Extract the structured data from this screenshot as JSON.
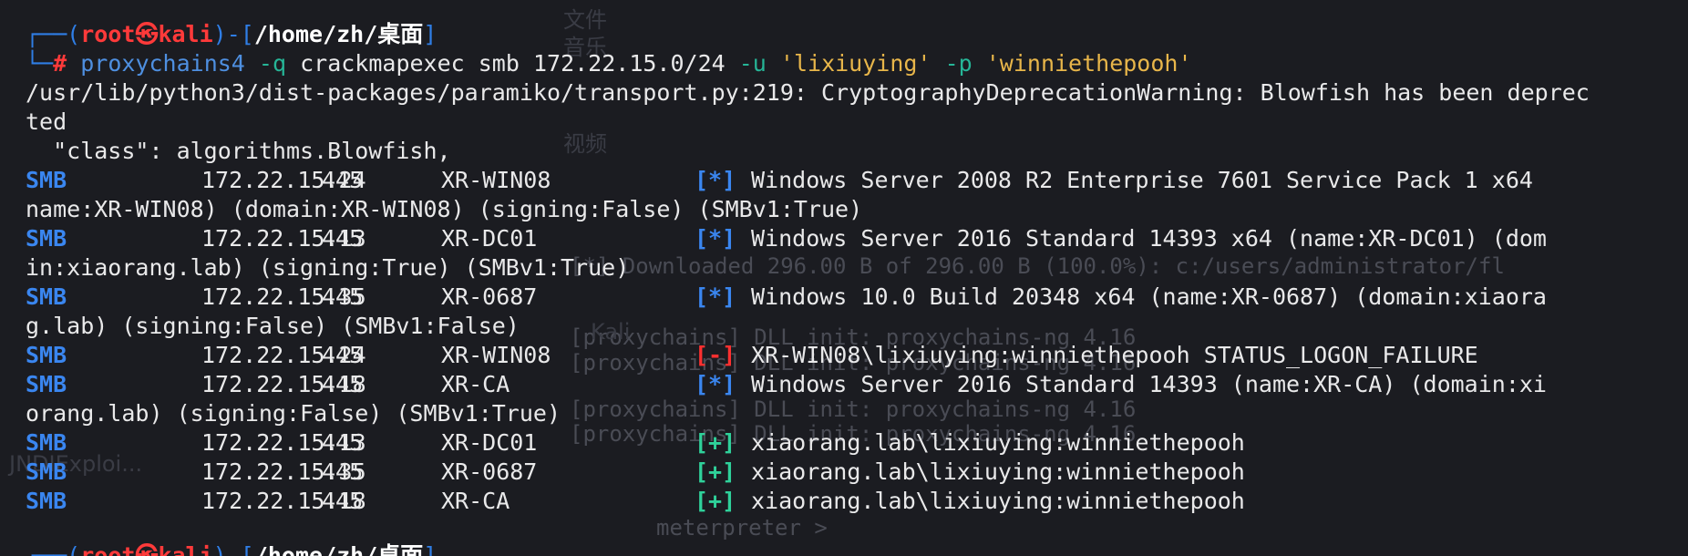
{
  "prompt": {
    "user": "root",
    "at_symbol": "㉿",
    "host": "kali",
    "cwd": "/home/zh/桌面",
    "hash": "#",
    "command": "proxychains4",
    "arg_q": "-q",
    "args1": "crackmapexec smb 172.22.15.0/24",
    "flag_u": "-u",
    "user_arg": "'lixiuying'",
    "flag_p": "-p",
    "pass_arg": "'winniethepooh'"
  },
  "warning": {
    "line1": "/usr/lib/python3/dist-packages/paramiko/transport.py:219: CryptographyDeprecationWarning: Blowfish has been deprec",
    "line2": "ted",
    "line3": "  \"class\": algorithms.Blowfish,"
  },
  "results": [
    {
      "proto": "SMB",
      "ip": "172.22.15.24",
      "port": "445",
      "host": "XR-WIN08",
      "tag": "[*]",
      "kind": "info",
      "msg": "Windows Server 2008 R2 Enterprise 7601 Service Pack 1 x64",
      "cont": "name:XR-WIN08) (domain:XR-WIN08) (signing:False) (SMBv1:True)"
    },
    {
      "proto": "SMB",
      "ip": "172.22.15.13",
      "port": "445",
      "host": "XR-DC01",
      "tag": "[*]",
      "kind": "info",
      "msg": "Windows Server 2016 Standard 14393 x64 (name:XR-DC01) (dom",
      "cont": "in:xiaorang.lab) (signing:True) (SMBv1:True)"
    },
    {
      "proto": "SMB",
      "ip": "172.22.15.35",
      "port": "445",
      "host": "XR-0687",
      "tag": "[*]",
      "kind": "info",
      "msg": "Windows 10.0 Build 20348 x64 (name:XR-0687) (domain:xiaora",
      "cont": "g.lab) (signing:False) (SMBv1:False)"
    },
    {
      "proto": "SMB",
      "ip": "172.22.15.24",
      "port": "445",
      "host": "XR-WIN08",
      "tag": "[-]",
      "kind": "fail",
      "msg": "XR-WIN08\\lixiuying:winniethepooh STATUS_LOGON_FAILURE",
      "cont": ""
    },
    {
      "proto": "SMB",
      "ip": "172.22.15.18",
      "port": "445",
      "host": "XR-CA",
      "tag": "[*]",
      "kind": "info",
      "msg": "Windows Server 2016 Standard 14393 (name:XR-CA) (domain:xi",
      "cont": "orang.lab) (signing:False) (SMBv1:True)"
    },
    {
      "proto": "SMB",
      "ip": "172.22.15.13",
      "port": "445",
      "host": "XR-DC01",
      "tag": "[+]",
      "kind": "ok",
      "msg": "xiaorang.lab\\lixiuying:winniethepooh",
      "cont": ""
    },
    {
      "proto": "SMB",
      "ip": "172.22.15.35",
      "port": "445",
      "host": "XR-0687",
      "tag": "[+]",
      "kind": "ok",
      "msg": "xiaorang.lab\\lixiuying:winniethepooh",
      "cont": ""
    },
    {
      "proto": "SMB",
      "ip": "172.22.15.18",
      "port": "445",
      "host": "XR-CA",
      "tag": "[+]",
      "kind": "ok",
      "msg": "xiaorang.lab\\lixiuying:winniethepooh",
      "cont": ""
    }
  ],
  "background_ghost": {
    "lines": [
      "[*] Downloaded 296.00 B of 296.00 B (100.0%): c:/users/administrator/fl",
      "[proxychains] DLL init: proxychains-ng 4.16",
      "[proxychains] DLL init: proxychains-ng 4.16",
      "[proxychains] DLL init: proxychains-ng 4.16",
      "[proxychains] DLL init: proxychains-ng 4.16",
      "meterpreter > "
    ],
    "cjk": [
      "文件",
      "音乐",
      "视频",
      "Kali",
      "JNDIExploi..."
    ]
  },
  "colors": {
    "background": "#1b1c21",
    "prompt_frame": "#2f7ee6",
    "root_red": "#ff3a3a",
    "smb_blue": "#3a86f0",
    "ok_green": "#2fd19a",
    "fail_red": "#ff3030",
    "string_yellow": "#e8b64a"
  }
}
